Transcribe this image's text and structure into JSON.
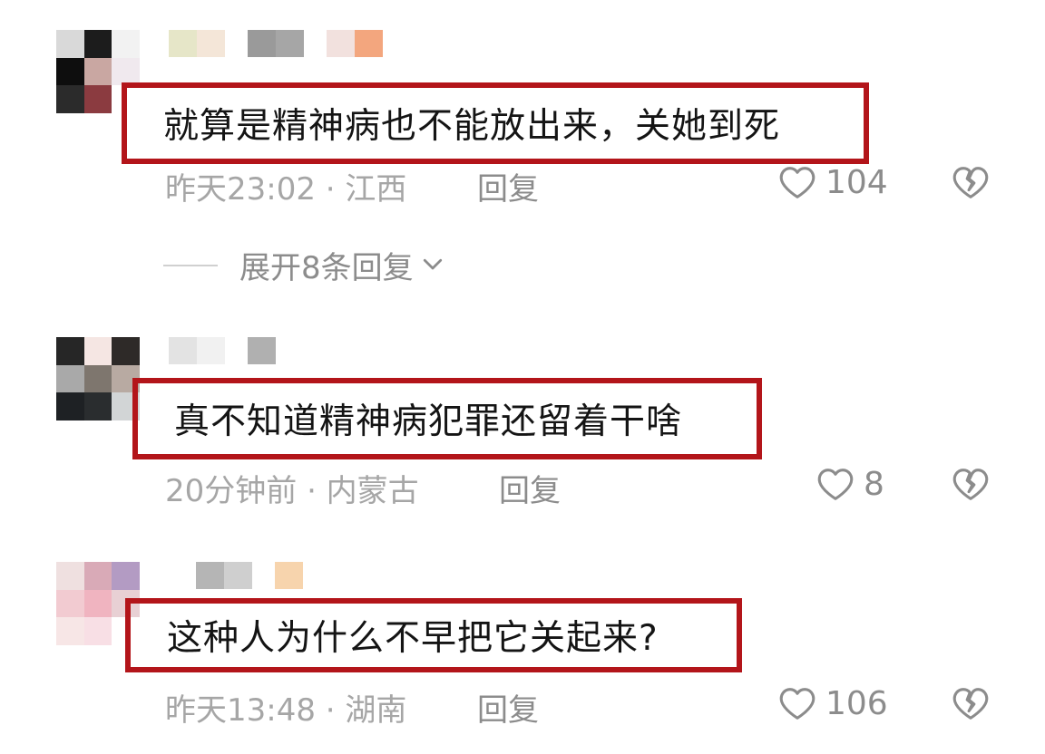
{
  "comments": [
    {
      "text": "就算是精神病也不能放出来，关她到死",
      "time_location": "昨天23:02 · 江西",
      "reply_label": "回复",
      "likes": "104",
      "avatar_colors": [
        "#d9d9d9",
        "#1c1c1c",
        "#f2f2f2",
        "#0e0e0e",
        "#c9a7a2",
        "#f0e9ee",
        "#2b2b2b",
        "#8b3b40",
        "#ffffff"
      ],
      "name_colors": [
        "#e6e6c8",
        "#f4e6d8",
        "#9a9a9a",
        "#a6a6a6",
        "#f2e1de",
        "#f3a67e"
      ]
    },
    {
      "text": "真不知道精神病犯罪还留着干啥",
      "time_location": "20分钟前 · 内蒙古",
      "reply_label": "回复",
      "likes": "8",
      "avatar_colors": [
        "#262626",
        "#f5e6e3",
        "#2e2a28",
        "#a9a9a9",
        "#7e766e",
        "#b8aaa2",
        "#1e2124",
        "#2a2d2f",
        "#d2d5d6"
      ],
      "name_colors": [
        "#e3e3e3",
        "#f1f1f1",
        "#b0b0b0"
      ]
    },
    {
      "text": "这种人为什么不早把它关起来?",
      "time_location": "昨天13:48 · 湖南",
      "reply_label": "回复",
      "likes": "106",
      "avatar_colors": [
        "#efe0e0",
        "#d9aab7",
        "#b39bc3",
        "#f2cbd1",
        "#f0b4c0",
        "#e8d0d4",
        "#f7e6e6",
        "#f8dfe5",
        "#ffffff"
      ],
      "name_colors": [
        "#b5b5b5",
        "#cfcfcf",
        "#f7d4ad"
      ]
    }
  ],
  "expand_replies_label": "展开8条回复",
  "colors": {
    "highlight_border": "#b3151a",
    "meta_text": "#a6a6a6",
    "icon": "#8c8c8c"
  },
  "icons": {
    "like": "heart-outline-icon",
    "dislike": "broken-heart-icon",
    "expand": "chevron-down-icon"
  }
}
